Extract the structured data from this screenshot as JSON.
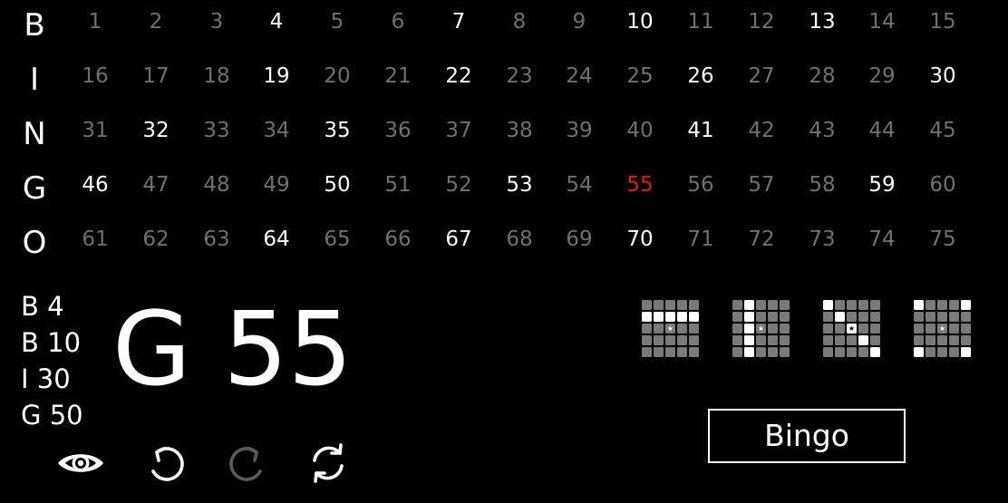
{
  "board": {
    "letters": [
      "B",
      "I",
      "N",
      "G",
      "O"
    ],
    "rows": [
      [
        "1",
        "2",
        "3",
        "4",
        "5",
        "6",
        "7",
        "8",
        "9",
        "10",
        "11",
        "12",
        "13",
        "14",
        "15"
      ],
      [
        "16",
        "17",
        "18",
        "19",
        "20",
        "21",
        "22",
        "23",
        "24",
        "25",
        "26",
        "27",
        "28",
        "29",
        "30"
      ],
      [
        "31",
        "32",
        "33",
        "34",
        "35",
        "36",
        "37",
        "38",
        "39",
        "40",
        "41",
        "42",
        "43",
        "44",
        "45"
      ],
      [
        "46",
        "47",
        "48",
        "49",
        "50",
        "51",
        "52",
        "53",
        "54",
        "55",
        "56",
        "57",
        "58",
        "59",
        "60"
      ],
      [
        "61",
        "62",
        "63",
        "64",
        "65",
        "66",
        "67",
        "68",
        "69",
        "70",
        "71",
        "72",
        "73",
        "74",
        "75"
      ]
    ],
    "called": [
      4,
      7,
      10,
      13,
      19,
      22,
      26,
      30,
      32,
      35,
      41,
      46,
      50,
      53,
      59,
      64,
      67,
      70
    ],
    "current": 55
  },
  "current_call": {
    "letter": "G",
    "number": "55",
    "label": "G 55"
  },
  "history": [
    "B 4",
    "B 10",
    "I 30",
    "G 50"
  ],
  "controls": [
    {
      "name": "eye-button",
      "icon": "eye-icon",
      "enabled": true
    },
    {
      "name": "undo-button",
      "icon": "undo-icon",
      "enabled": true
    },
    {
      "name": "redo-button",
      "icon": "redo-icon",
      "enabled": false
    },
    {
      "name": "reset-button",
      "icon": "refresh-icon",
      "enabled": true
    }
  ],
  "patterns": [
    {
      "name": "pattern-row",
      "marked": [
        [
          1,
          0
        ],
        [
          1,
          1
        ],
        [
          1,
          2
        ],
        [
          1,
          3
        ],
        [
          1,
          4
        ]
      ]
    },
    {
      "name": "pattern-column",
      "marked": [
        [
          0,
          1
        ],
        [
          1,
          1
        ],
        [
          2,
          1
        ],
        [
          3,
          1
        ],
        [
          4,
          1
        ]
      ]
    },
    {
      "name": "pattern-diagonal",
      "marked": [
        [
          0,
          0
        ],
        [
          1,
          1
        ],
        [
          2,
          2
        ],
        [
          3,
          3
        ],
        [
          4,
          4
        ]
      ]
    },
    {
      "name": "pattern-corners",
      "marked": [
        [
          0,
          0
        ],
        [
          0,
          4
        ],
        [
          4,
          0
        ],
        [
          4,
          4
        ]
      ]
    }
  ],
  "bingo_button": {
    "label": "Bingo"
  },
  "colors": {
    "background": "#000000",
    "called": "#ffffff",
    "uncalled": "#6f6f6f",
    "current": "#e31919",
    "pattern_off": "#7a7a7a",
    "pattern_on": "#ffffff"
  }
}
